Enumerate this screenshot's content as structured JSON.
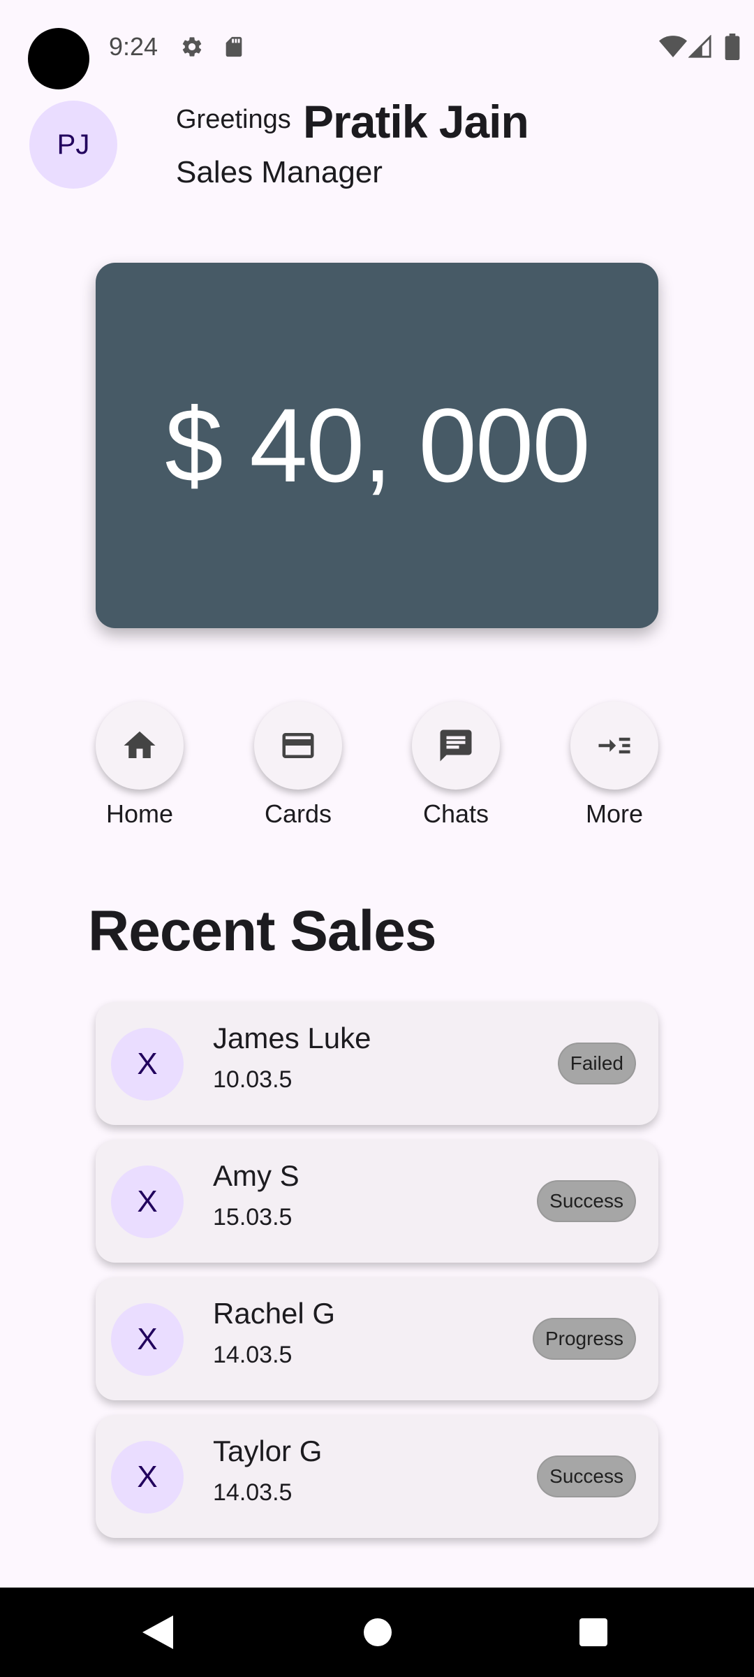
{
  "status_bar": {
    "time": "9:24",
    "icons": [
      "gear-icon",
      "sd-card-icon",
      "wifi-icon",
      "signal-icon",
      "battery-icon"
    ]
  },
  "header": {
    "avatar_initials": "PJ",
    "greeting": "Greetings",
    "name": "Pratik Jain",
    "role": "Sales Manager"
  },
  "balance": {
    "amount": "$ 40, 000",
    "card_color": "#475a66"
  },
  "actions": [
    {
      "label": "Home",
      "icon": "home-icon"
    },
    {
      "label": "Cards",
      "icon": "credit-card-icon"
    },
    {
      "label": "Chats",
      "icon": "chat-icon"
    },
    {
      "label": "More",
      "icon": "more-icon"
    }
  ],
  "recent_sales": {
    "title": "Recent Sales",
    "items": [
      {
        "avatar": "X",
        "name": "James Luke",
        "date": "10.03.5",
        "status": "Failed"
      },
      {
        "avatar": "X",
        "name": "Amy S",
        "date": "15.03.5",
        "status": "Success"
      },
      {
        "avatar": "X",
        "name": "Rachel G",
        "date": "14.03.5",
        "status": "Progress"
      },
      {
        "avatar": "X",
        "name": "Taylor G",
        "date": "14.03.5",
        "status": "Success"
      }
    ]
  },
  "colors": {
    "background": "#fdf7fe",
    "avatar_bg": "#eaddff",
    "badge_bg": "#a6a6a6"
  }
}
